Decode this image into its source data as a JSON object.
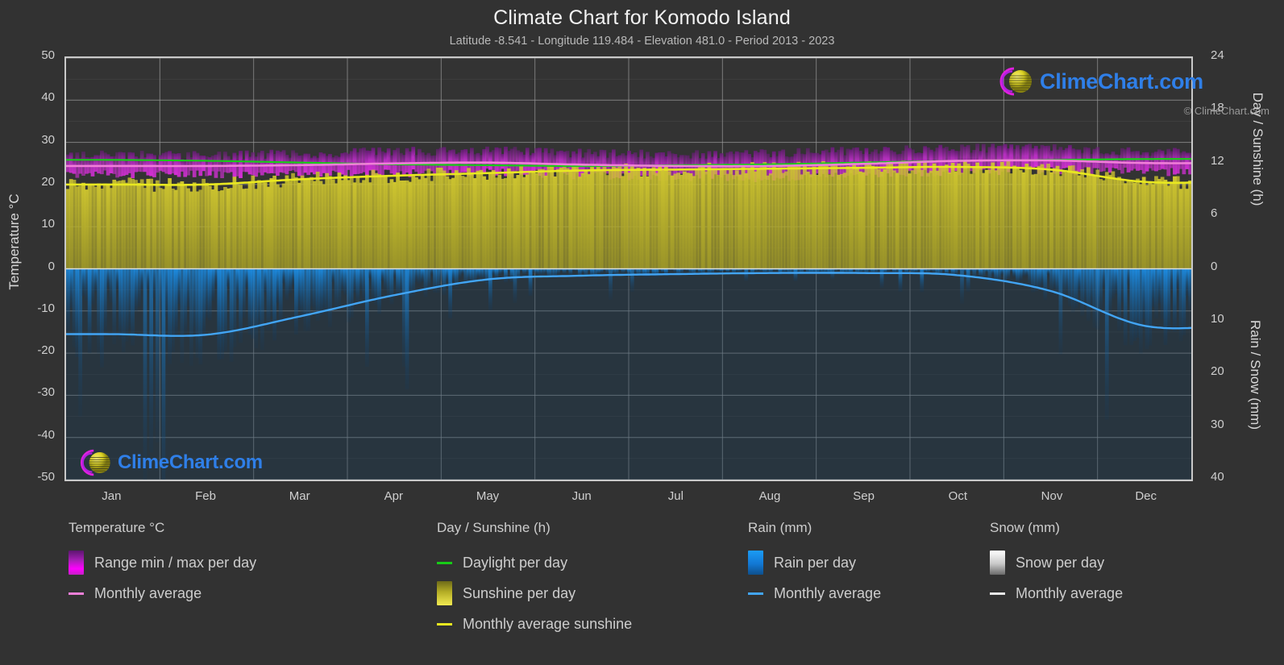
{
  "header": {
    "title": "Climate Chart for Komodo Island",
    "subtitle": "Latitude -8.541 - Longitude 119.484 - Elevation 481.0 - Period 2013 - 2023"
  },
  "watermark": {
    "text": "ClimeChart.com",
    "logo_arc_color": "#e020e0",
    "logo_ball_color": "#d8d020",
    "text_color": "#2f7fe8"
  },
  "copyright": "© ClimeChart.com",
  "axes": {
    "left_title": "Temperature °C",
    "right_top_title": "Day / Sunshine (h)",
    "right_bottom_title": "Rain / Snow (mm)",
    "left_ticks": [
      "50",
      "40",
      "30",
      "20",
      "10",
      "0",
      "-10",
      "-20",
      "-30",
      "-40",
      "-50"
    ],
    "right_top_ticks": [
      "24",
      "18",
      "12",
      "6",
      "0"
    ],
    "right_bottom_ticks": [
      "10",
      "20",
      "30",
      "40"
    ],
    "months": [
      "Jan",
      "Feb",
      "Mar",
      "Apr",
      "May",
      "Jun",
      "Jul",
      "Aug",
      "Sep",
      "Oct",
      "Nov",
      "Dec"
    ]
  },
  "legend": {
    "columns": [
      {
        "title": "Temperature °C",
        "items": [
          {
            "label": "Range min / max per day",
            "type": "swatch",
            "color": "#e600e6"
          },
          {
            "label": "Monthly average",
            "type": "line",
            "color": "#f07fd8"
          }
        ]
      },
      {
        "title": "Day / Sunshine (h)",
        "items": [
          {
            "label": "Daylight per day",
            "type": "line",
            "color": "#17cc17"
          },
          {
            "label": "Sunshine per day",
            "type": "swatch",
            "color": "#e8e840"
          },
          {
            "label": "Monthly average sunshine",
            "type": "line",
            "color": "#e8e820"
          }
        ]
      },
      {
        "title": "Rain (mm)",
        "items": [
          {
            "label": "Rain per day",
            "type": "swatch",
            "color": "#1489e8"
          },
          {
            "label": "Monthly average",
            "type": "line",
            "color": "#42a5f5"
          }
        ]
      },
      {
        "title": "Snow (mm)",
        "items": [
          {
            "label": "Snow per day",
            "type": "swatch",
            "color": "#e8e8e8"
          },
          {
            "label": "Monthly average",
            "type": "line",
            "color": "#e8e8e8"
          }
        ]
      }
    ]
  },
  "chart_data": {
    "type": "area",
    "title": "Climate Chart for Komodo Island",
    "subtitle": "Latitude -8.541 - Longitude 119.484 - Elevation 481.0 - Period 2013 - 2023",
    "xlabel": "",
    "ylabel": "Temperature °C",
    "ylim": [
      -50,
      50
    ],
    "y2_top_label": "Day / Sunshine (h)",
    "y2_top_lim": [
      0,
      24
    ],
    "y2_bottom_label": "Rain / Snow (mm)",
    "y2_bottom_lim": [
      0,
      40
    ],
    "grid": true,
    "legend_position": "below",
    "categories": [
      "Jan",
      "Feb",
      "Mar",
      "Apr",
      "May",
      "Jun",
      "Jul",
      "Aug",
      "Sep",
      "Oct",
      "Nov",
      "Dec"
    ],
    "series": [
      {
        "name": "Monthly average temperature (°C)",
        "unit": "°C",
        "color": "#f07fd8",
        "values": [
          24.4,
          24.4,
          24.6,
          25.0,
          25.2,
          24.7,
          24.4,
          24.4,
          24.9,
          25.6,
          25.7,
          25.1
        ]
      },
      {
        "name": "Daily max temperature (°C)",
        "unit": "°C",
        "color": "#e600e6",
        "values": [
          27.0,
          27.0,
          27.3,
          27.8,
          28.0,
          27.4,
          27.2,
          27.4,
          28.0,
          28.6,
          28.6,
          27.8
        ]
      },
      {
        "name": "Daily min temperature (°C)",
        "unit": "°C",
        "color": "#8b1a8b",
        "values": [
          22.4,
          22.4,
          22.4,
          22.6,
          22.8,
          22.2,
          21.6,
          21.5,
          22.0,
          22.9,
          23.3,
          23.0
        ]
      },
      {
        "name": "Daylight per day (h)",
        "unit": "h",
        "color": "#17cc17",
        "values": [
          12.4,
          12.3,
          12.1,
          11.9,
          11.8,
          11.7,
          11.8,
          11.9,
          12.1,
          12.3,
          12.4,
          12.5
        ]
      },
      {
        "name": "Monthly average sunshine (h)",
        "unit": "h",
        "color": "#e8e820",
        "values": [
          9.6,
          9.6,
          10.2,
          10.6,
          10.9,
          11.2,
          11.3,
          11.4,
          11.5,
          11.6,
          11.3,
          9.9
        ]
      },
      {
        "name": "Monthly average rain (mm)",
        "unit": "mm",
        "color": "#42a5f5",
        "values": [
          12.4,
          12.5,
          9.0,
          5.0,
          2.0,
          1.3,
          1.0,
          0.8,
          0.8,
          1.2,
          4.2,
          10.8
        ]
      },
      {
        "name": "Monthly average snow (mm)",
        "unit": "mm",
        "color": "#e8e8e8",
        "values": [
          0,
          0,
          0,
          0,
          0,
          0,
          0,
          0,
          0,
          0,
          0,
          0
        ]
      }
    ]
  }
}
